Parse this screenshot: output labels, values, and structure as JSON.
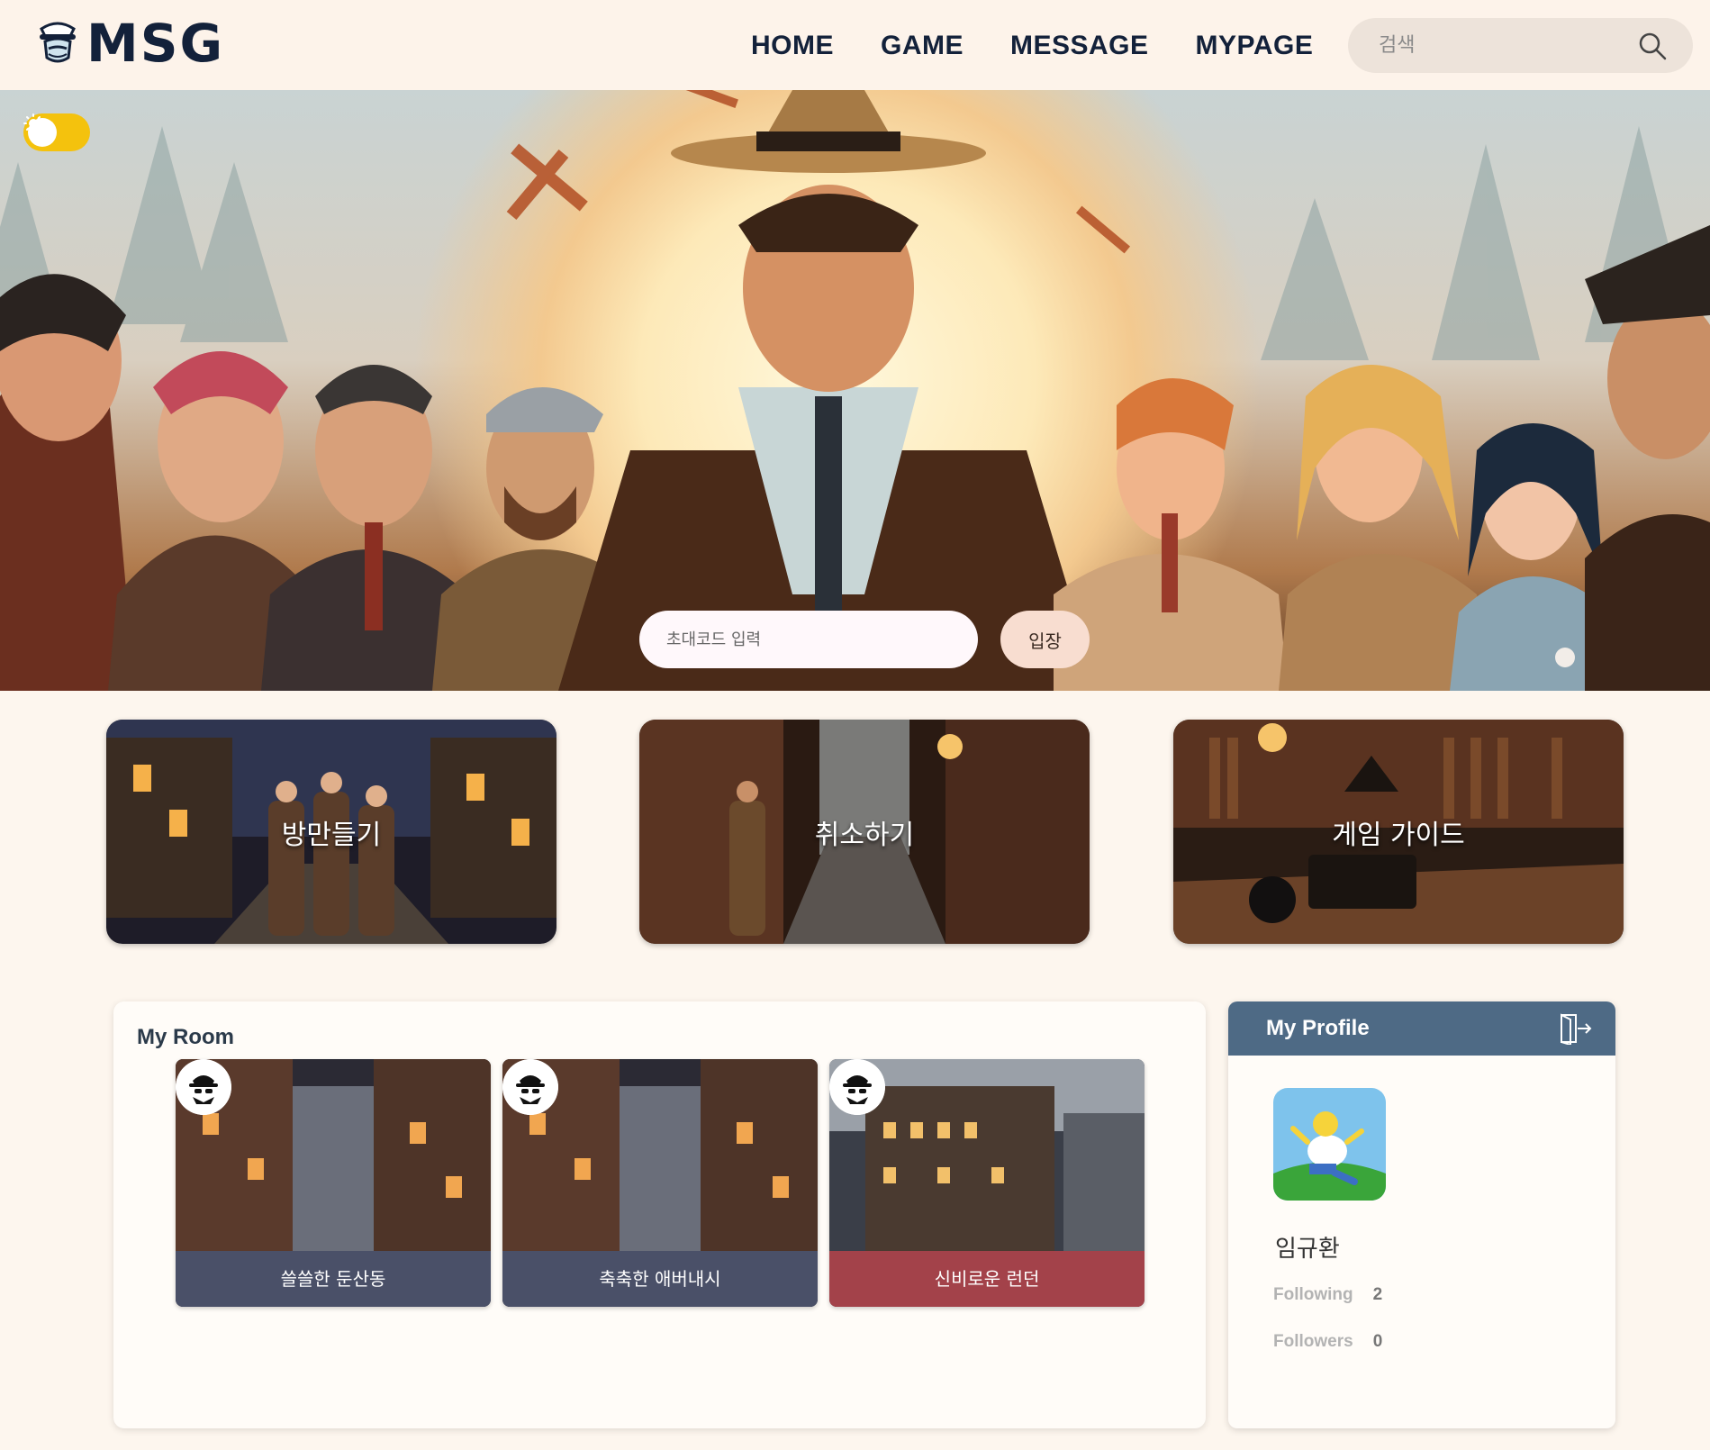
{
  "app": {
    "logo_text": "MSG"
  },
  "nav": {
    "items": [
      "HOME",
      "GAME",
      "MESSAGE",
      "MYPAGE"
    ]
  },
  "search": {
    "placeholder": "검색"
  },
  "hero": {
    "invite_placeholder": "초대코드 입력",
    "enter_label": "입장"
  },
  "actions": [
    {
      "label": "방만들기"
    },
    {
      "label": "취소하기"
    },
    {
      "label": "게임 가이드"
    }
  ],
  "my_room": {
    "title": "My Room",
    "rooms": [
      {
        "name": "쓸쓸한 둔산동",
        "color": "#4a5068"
      },
      {
        "name": "축축한 애버내시",
        "color": "#4a5068"
      },
      {
        "name": "신비로운 런던",
        "color": "#a3424a"
      }
    ]
  },
  "profile": {
    "title": "My Profile",
    "name": "임규환",
    "following_label": "Following",
    "following_count": "2",
    "followers_label": "Followers",
    "followers_count": "0"
  },
  "theme": {
    "header_bg": "#fdf3ea",
    "page_bg": "#fdf6ee",
    "accent_yellow": "#f4c20d",
    "profile_header": "#4e6a85"
  },
  "icons": [
    "logo-detective-icon",
    "search-icon",
    "sun-icon",
    "detective-badge-icon",
    "logout-icon"
  ]
}
